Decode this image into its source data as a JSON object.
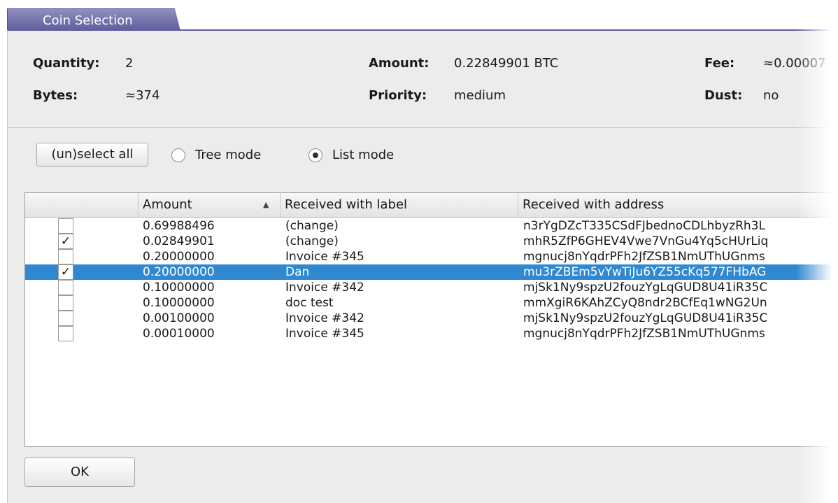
{
  "window": {
    "title": "Coin Selection"
  },
  "summary": {
    "quantity_label": "Quantity:",
    "quantity_value": "2",
    "amount_label": "Amount:",
    "amount_value": "0.22849901 BTC",
    "fee_label": "Fee:",
    "fee_value": "≈0.00007",
    "bytes_label": "Bytes:",
    "bytes_value": "≈374",
    "priority_label": "Priority:",
    "priority_value": "medium",
    "dust_label": "Dust:",
    "dust_value": "no"
  },
  "controls": {
    "select_all_label": "(un)select all",
    "tree_mode_label": "Tree mode",
    "list_mode_label": "List mode",
    "selected_mode": "list"
  },
  "table": {
    "columns": [
      "",
      "Amount",
      "Received with label",
      "Received with address"
    ],
    "sort_column": "Amount",
    "rows": [
      {
        "checked": false,
        "amount": "0.69988496",
        "label": "(change)",
        "address": "n3rYgDZcT335CSdFJbednoCDLhbyzRh3L",
        "selected": false
      },
      {
        "checked": true,
        "amount": "0.02849901",
        "label": "(change)",
        "address": "mhR5ZfP6GHEV4Vwe7VnGu4Yq5cHUrLiq",
        "selected": false
      },
      {
        "checked": false,
        "amount": "0.20000000",
        "label": "Invoice #345",
        "address": "mgnucj8nYqdrPFh2JfZSB1NmUThUGnms",
        "selected": false
      },
      {
        "checked": true,
        "amount": "0.20000000",
        "label": "Dan",
        "address": "mu3rZBEm5vYwTiJu6YZ55cKq577FHbAG",
        "selected": true
      },
      {
        "checked": false,
        "amount": "0.10000000",
        "label": "Invoice #342",
        "address": "mjSk1Ny9spzU2fouzYgLqGUD8U41iR35C",
        "selected": false
      },
      {
        "checked": false,
        "amount": "0.10000000",
        "label": "doc test",
        "address": "mmXgiR6KAhZCyQ8ndr2BCfEq1wNG2Un",
        "selected": false
      },
      {
        "checked": false,
        "amount": "0.00100000",
        "label": "Invoice #342",
        "address": "mjSk1Ny9spzU2fouzYgLqGUD8U41iR35C",
        "selected": false
      },
      {
        "checked": false,
        "amount": "0.00010000",
        "label": "Invoice #345",
        "address": "mgnucj8nYqdrPFh2JfZSB1NmUThUGnms",
        "selected": false
      }
    ],
    "check_glyph": "✓"
  },
  "footer": {
    "ok_label": "OK"
  },
  "colors": {
    "selection": "#3088d0",
    "title_tab": "#5e5e9e"
  }
}
